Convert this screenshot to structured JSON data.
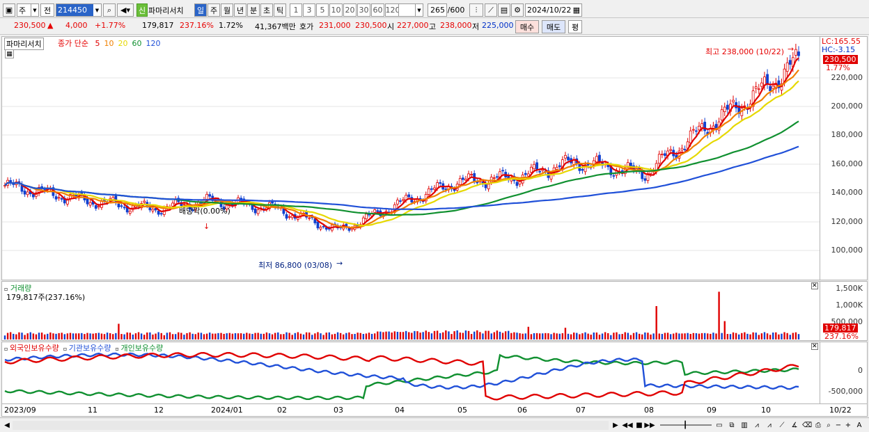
{
  "toolbar": {
    "type_select": "주",
    "market_select": "전",
    "code": "214450",
    "badge": "신",
    "stock_name": "파마리서치",
    "periods": [
      "일",
      "주",
      "월",
      "년",
      "분",
      "초",
      "틱"
    ],
    "active_period": "일",
    "intervals": [
      "1",
      "3",
      "5",
      "10",
      "20",
      "30",
      "60",
      "120"
    ],
    "count": "265",
    "count_max": "/600",
    "date": "2024/10/22"
  },
  "quote": {
    "price": "230,500",
    "up_mark": "▲",
    "change": "4,000",
    "change_pct": "+1.77%",
    "volume": "179,817",
    "volume_ratio": "237.16%",
    "turnover": "1.72%",
    "amount": "41,367백만",
    "ask_label": "호가",
    "ask": "231,000",
    "bid": "230,500",
    "open_label": "시",
    "open": "227,000",
    "high_label": "고",
    "high": "238,000",
    "low_label": "저",
    "low": "225,000",
    "buy_label": "매수",
    "sell_label": "매도",
    "flat_label": "평"
  },
  "price_panel": {
    "title": "파마리서치",
    "ma_label": "종가 단순",
    "ma_periods": [
      {
        "p": "5",
        "color": "#e00000"
      },
      {
        "p": "10",
        "color": "#f08000"
      },
      {
        "p": "20",
        "color": "#e6d800"
      },
      {
        "p": "60",
        "color": "#109030"
      },
      {
        "p": "120",
        "color": "#2050d8"
      }
    ],
    "lc": "LC:165.55",
    "hc": "HC:-3.15",
    "current_tag": "230,500",
    "current_pct": "1.77%",
    "high_note": "최고 238,000 (10/22)",
    "low_note": "최저 86,800 (03/08)",
    "dividend_note": "배당락(0.00%)",
    "y_labels": [
      "220,000",
      "200,000",
      "180,000",
      "160,000",
      "140,000",
      "120,000",
      "100,000"
    ]
  },
  "volume_panel": {
    "title": "거래량",
    "value": "179,817주(237.16%)",
    "y_labels": [
      "1,500K",
      "1,000K",
      "500,000"
    ],
    "current_tag": "179,817",
    "current_pct": "237.16%"
  },
  "holding_panel": {
    "legends": [
      {
        "label": "외국인보유수량",
        "color": "#e00000"
      },
      {
        "label": "기관보유수량",
        "color": "#2050d8"
      },
      {
        "label": "개인보유수량",
        "color": "#109030"
      }
    ],
    "y_labels": [
      "0",
      "-500,000"
    ]
  },
  "x_axis": [
    "2023/09",
    "11",
    "12",
    "2024/01",
    "02",
    "03",
    "04",
    "05",
    "06",
    "07",
    "08",
    "09",
    "10",
    "10/22"
  ],
  "chart_data": {
    "type": "candlestick",
    "x_range": [
      "2023/09",
      "2024/10/22"
    ],
    "y_range": [
      86800,
      238000
    ],
    "close_checkpoints": [
      {
        "x": "2023/09",
        "y": 125000
      },
      {
        "x": "2023/11",
        "y": 112000
      },
      {
        "x": "2023/12",
        "y": 105000
      },
      {
        "x": "2024/01",
        "y": 112000
      },
      {
        "x": "2024/02",
        "y": 105000
      },
      {
        "x": "2024/03/08",
        "y": 86800
      },
      {
        "x": "2024/04",
        "y": 108000
      },
      {
        "x": "2024/05",
        "y": 128000
      },
      {
        "x": "2024/06",
        "y": 132000
      },
      {
        "x": "2024/07",
        "y": 145000
      },
      {
        "x": "2024/08",
        "y": 135000
      },
      {
        "x": "2024/09",
        "y": 175000
      },
      {
        "x": "2024/10",
        "y": 205000
      },
      {
        "x": "2024/10/22",
        "y": 230500
      }
    ]
  }
}
